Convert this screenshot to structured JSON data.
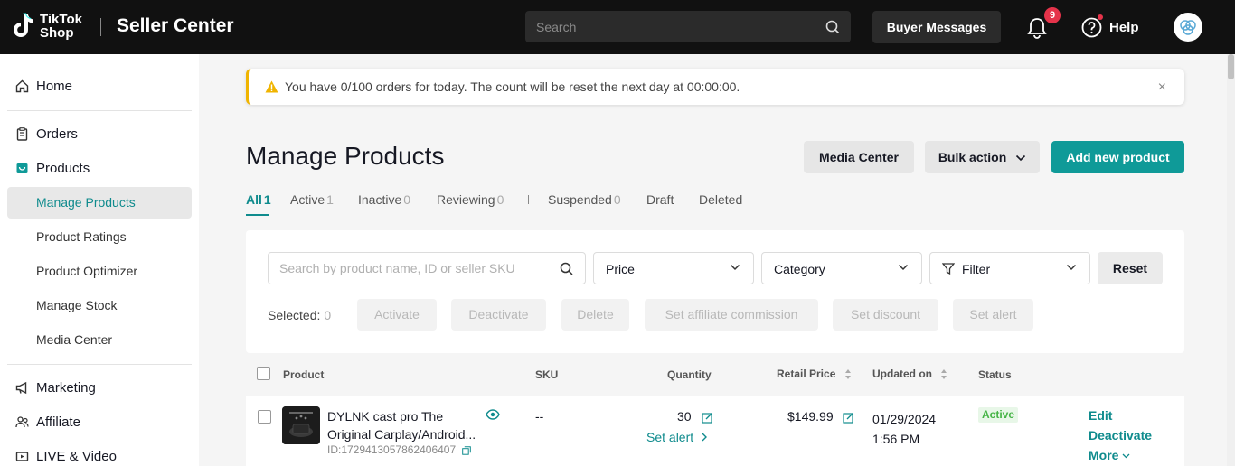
{
  "colors": {
    "accent": "#0f9a98",
    "topbar": "#111111",
    "alert_border": "#f0b400",
    "badge": "#e5334a",
    "status_active": "#46b446"
  },
  "header": {
    "logo_line1": "TikTok",
    "logo_line2": "Shop",
    "title": "Seller Center",
    "search_placeholder": "Search",
    "buyer_messages": "Buyer Messages",
    "notification_count": "9",
    "help": "Help"
  },
  "sidebar": {
    "home": "Home",
    "orders": "Orders",
    "products": "Products",
    "sub_items": [
      "Manage Products",
      "Product Ratings",
      "Product Optimizer",
      "Manage Stock",
      "Media Center"
    ],
    "marketing": "Marketing",
    "affiliate": "Affiliate",
    "live": "LIVE & Video"
  },
  "alert": {
    "message": "You have 0/100 orders for today. The count will be reset the next day at 00:00:00.",
    "close": "×"
  },
  "page": {
    "title": "Manage Products",
    "media_center": "Media Center",
    "bulk_action": "Bulk action",
    "add_new": "Add new product"
  },
  "tabs": [
    {
      "label": "All",
      "count": "1"
    },
    {
      "label": "Active",
      "count": "1"
    },
    {
      "label": "Inactive",
      "count": "0"
    },
    {
      "label": "Reviewing",
      "count": "0"
    },
    {
      "label": "Suspended",
      "count": "0"
    },
    {
      "label": "Draft",
      "count": ""
    },
    {
      "label": "Deleted",
      "count": ""
    }
  ],
  "filters": {
    "search_placeholder": "Search by product name, ID or seller SKU",
    "price": "Price",
    "category": "Category",
    "filter": "Filter",
    "reset": "Reset",
    "selected_label": "Selected:",
    "selected_count": "0",
    "bulk_buttons": [
      "Activate",
      "Deactivate",
      "Delete",
      "Set affiliate commission",
      "Set discount",
      "Set alert"
    ]
  },
  "table": {
    "headers": {
      "product": "Product",
      "sku": "SKU",
      "quantity": "Quantity",
      "retail_price": "Retail Price",
      "updated_on": "Updated on",
      "status": "Status"
    },
    "rows": [
      {
        "name_line1": "DYLNK cast pro The",
        "name_line2": "Original Carplay/Android...",
        "id": "ID:1729413057862406407",
        "sku": "--",
        "quantity": "30",
        "set_alert": "Set alert",
        "price": "$149.99",
        "updated_date": "01/29/2024",
        "updated_time": "1:56 PM",
        "status": "Active",
        "actions": {
          "edit": "Edit",
          "deactivate": "Deactivate",
          "more": "More"
        }
      }
    ]
  }
}
